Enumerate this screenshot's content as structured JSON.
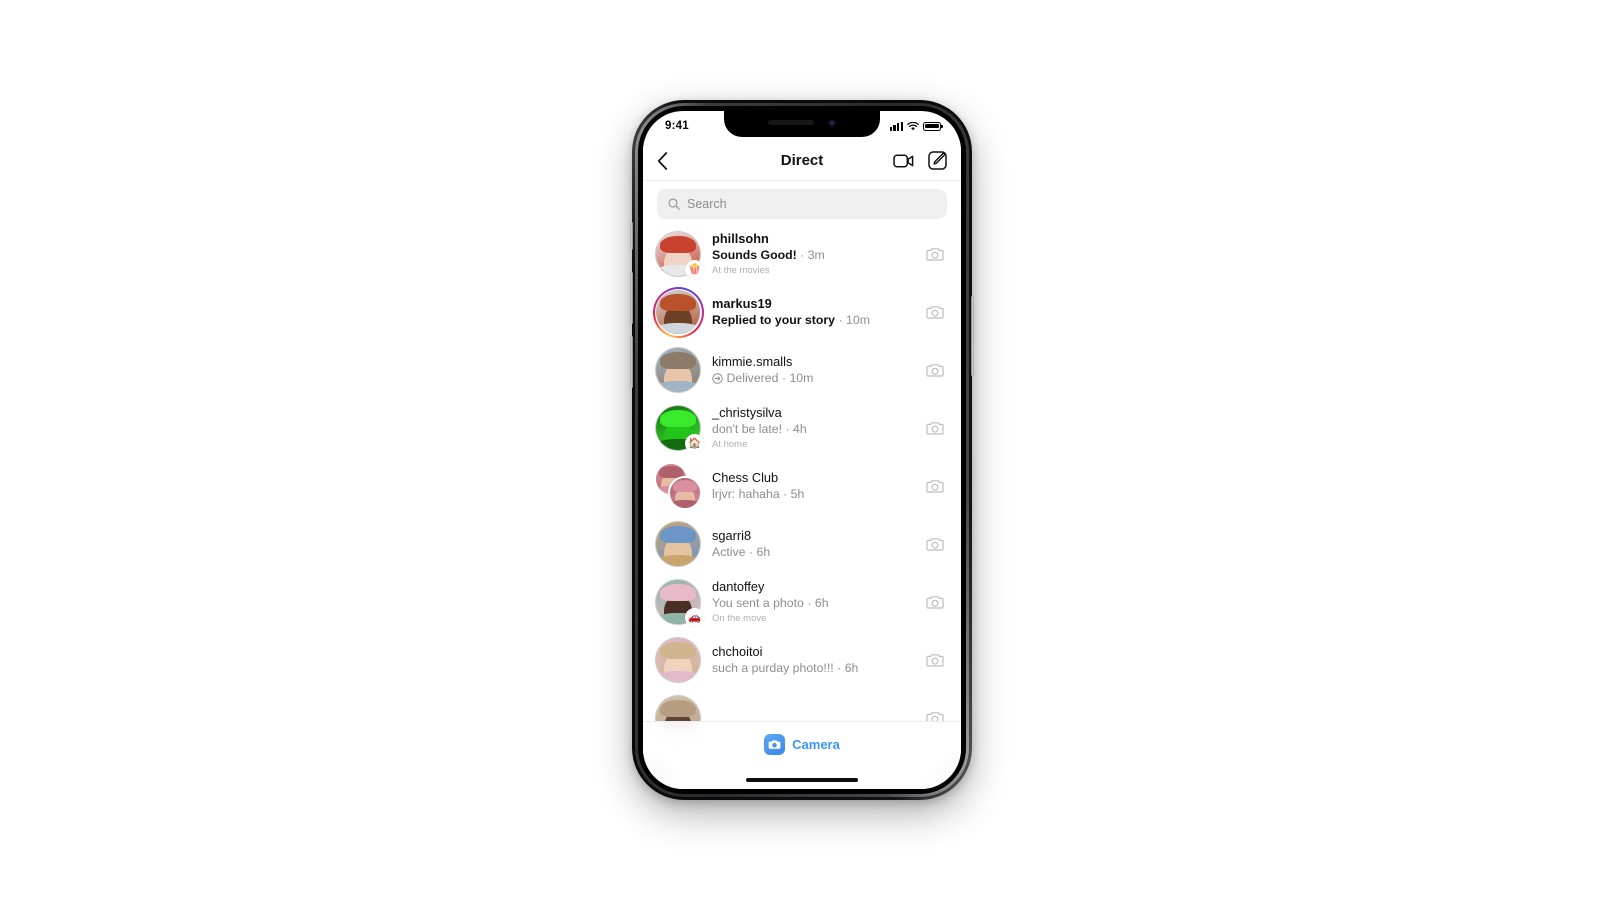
{
  "device": {
    "type": "iphone-x-mockup"
  },
  "status_bar": {
    "time": "9:41",
    "icons": [
      "signal-bars-icon",
      "wifi-icon",
      "battery-icon"
    ]
  },
  "nav": {
    "back_icon": "chevron-left-icon",
    "title": "Direct",
    "video_call_icon": "video-camera-icon",
    "compose_icon": "compose-pencil-icon"
  },
  "search": {
    "icon": "search-icon",
    "placeholder": "Search",
    "value": ""
  },
  "conversations": [
    {
      "name": "phillsohn",
      "preview": "Sounds Good!",
      "time": "3m",
      "note": "At the movies",
      "unread": true,
      "badge_emoji": "🍿",
      "story_ring": false,
      "group": false,
      "delivered": false,
      "camera_icon": "camera-icon",
      "avatar_colors": [
        "#c9412f",
        "#f0d3c4",
        "#e8e8e8"
      ]
    },
    {
      "name": "markus19",
      "preview": "Replied to your story",
      "time": "10m",
      "note": "",
      "unread": true,
      "badge_emoji": "",
      "story_ring": true,
      "group": false,
      "delivered": false,
      "camera_icon": "camera-icon",
      "avatar_colors": [
        "#b9522a",
        "#6b4027",
        "#cfd7dd"
      ]
    },
    {
      "name": "kimmie.smalls",
      "preview": "Delivered",
      "time": "10m",
      "note": "",
      "unread": false,
      "badge_emoji": "",
      "story_ring": false,
      "group": false,
      "delivered": true,
      "camera_icon": "camera-icon",
      "avatar_colors": [
        "#8d7a68",
        "#e8c4ab",
        "#9fb4c4"
      ]
    },
    {
      "name": "_christysilva",
      "preview": "don't be late!",
      "time": "4h",
      "note": "At home",
      "unread": false,
      "badge_emoji": "🏠",
      "story_ring": false,
      "group": false,
      "delivered": false,
      "camera_icon": "camera-icon",
      "avatar_colors": [
        "#3ae82c",
        "#23c41a",
        "#146b10"
      ]
    },
    {
      "name": "Chess Club",
      "preview": "lrjvr: hahaha",
      "time": "5h",
      "note": "",
      "unread": false,
      "badge_emoji": "",
      "story_ring": false,
      "group": true,
      "delivered": false,
      "camera_icon": "camera-icon",
      "avatar_colors": [
        "#b0606a",
        "#e8bca4",
        "#d88fa0"
      ]
    },
    {
      "name": "sgarri8",
      "preview": "Active",
      "time": "6h",
      "note": "",
      "unread": false,
      "badge_emoji": "",
      "story_ring": false,
      "group": false,
      "delivered": false,
      "camera_icon": "camera-icon",
      "avatar_colors": [
        "#6d96c8",
        "#e3c49e",
        "#c9a46f"
      ]
    },
    {
      "name": "dantoffey",
      "preview": "You sent a photo",
      "time": "6h",
      "note": "On the move",
      "unread": false,
      "badge_emoji": "🚗",
      "story_ring": false,
      "group": false,
      "delivered": false,
      "camera_icon": "camera-icon",
      "avatar_colors": [
        "#e8b9c6",
        "#4a2f24",
        "#8fb6a8"
      ]
    },
    {
      "name": "chchoitoi",
      "preview": "such a purday photo!!!",
      "time": "6h",
      "note": "",
      "unread": false,
      "badge_emoji": "",
      "story_ring": false,
      "group": false,
      "delivered": false,
      "camera_icon": "camera-icon",
      "avatar_colors": [
        "#cfb58d",
        "#f0d2bd",
        "#e3b9cc"
      ]
    },
    {
      "name": "",
      "preview": "",
      "time": "",
      "note": "",
      "unread": false,
      "badge_emoji": "",
      "story_ring": false,
      "group": false,
      "delivered": false,
      "camera_icon": "camera-icon",
      "avatar_colors": [
        "#b79d82",
        "#5d4436",
        "#d6c3b0"
      ]
    }
  ],
  "separator": "·",
  "bottom_bar": {
    "camera_icon": "camera-icon",
    "camera_label": "Camera",
    "accent_color": "#3897f0"
  }
}
